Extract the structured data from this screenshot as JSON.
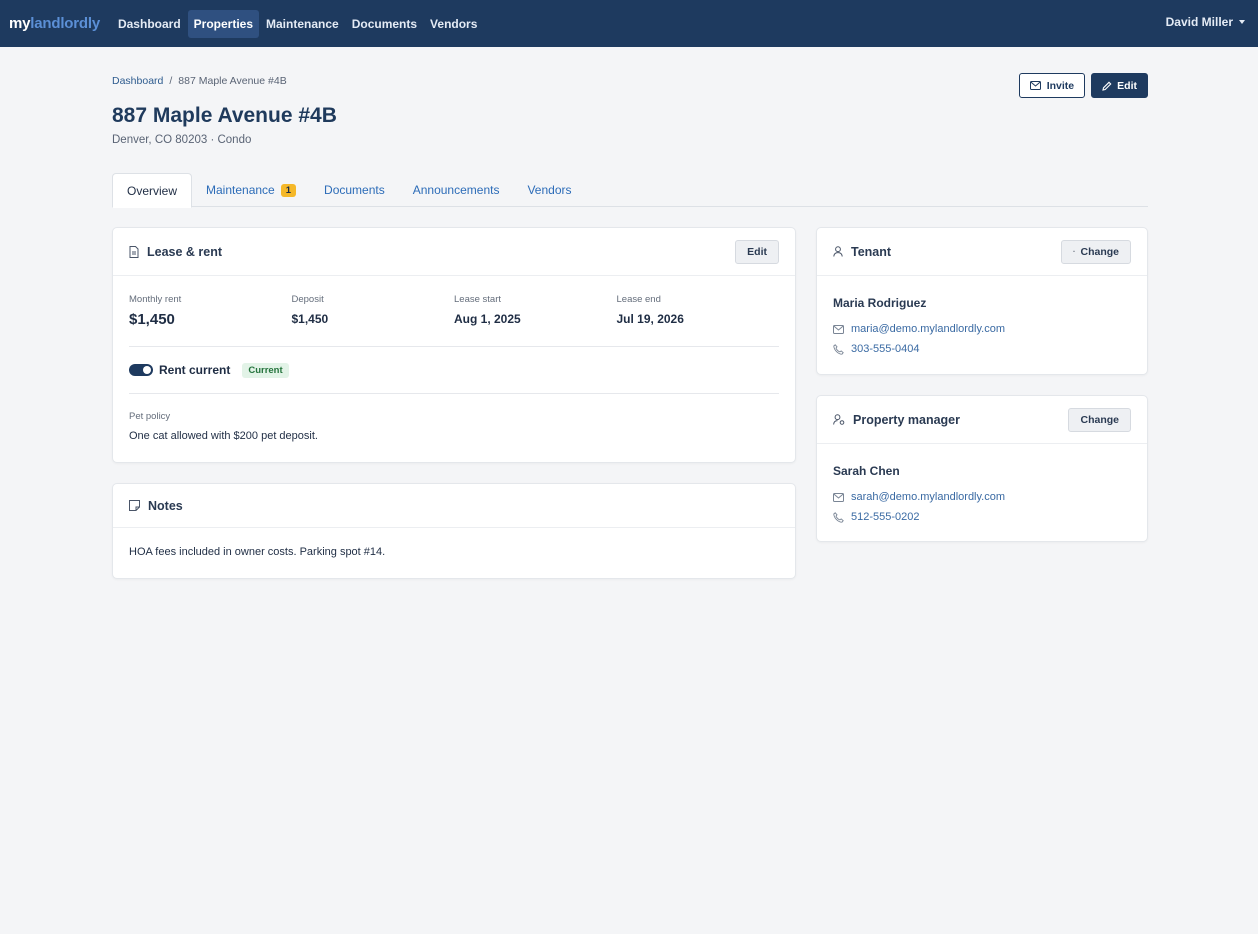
{
  "brand": {
    "part1": "my",
    "part2": "landlordly"
  },
  "nav": [
    {
      "label": "Dashboard"
    },
    {
      "label": "Properties"
    },
    {
      "label": "Maintenance"
    },
    {
      "label": "Documents"
    },
    {
      "label": "Vendors"
    }
  ],
  "user": {
    "name": "David Miller"
  },
  "breadcrumb": {
    "home": "Dashboard",
    "sep": "/",
    "current": "887 Maple Avenue #4B"
  },
  "actions": {
    "invite": "Invite",
    "edit": "Edit"
  },
  "property": {
    "title": "887 Maple Avenue #4B",
    "subtitle": "Denver, CO 80203 · Condo"
  },
  "tabs": [
    {
      "label": "Overview"
    },
    {
      "label": "Maintenance",
      "badge": "1"
    },
    {
      "label": "Documents"
    },
    {
      "label": "Announcements"
    },
    {
      "label": "Vendors"
    }
  ],
  "lease": {
    "title": "Lease & rent",
    "edit": "Edit",
    "monthly_rent_label": "Monthly rent",
    "monthly_rent": "$1,450",
    "deposit_label": "Deposit",
    "deposit": "$1,450",
    "lease_start_label": "Lease start",
    "lease_start": "Aug 1, 2025",
    "lease_end_label": "Lease end",
    "lease_end": "Jul 19, 2026",
    "rent_current_label": "Rent current",
    "rent_status": "Current",
    "pet_policy_label": "Pet policy",
    "pet_policy": "One cat allowed with $200 pet deposit."
  },
  "notes": {
    "title": "Notes",
    "text": "HOA fees included in owner costs. Parking spot #14."
  },
  "tenant": {
    "title": "Tenant",
    "change": "Change",
    "name": "Maria Rodriguez",
    "email": "maria@demo.mylandlordly.com",
    "phone": "303-555-0404"
  },
  "manager": {
    "title": "Property manager",
    "change": "Change",
    "name": "Sarah Chen",
    "email": "sarah@demo.mylandlordly.com",
    "phone": "512-555-0202"
  },
  "colors": {
    "navbar": "#1e3a5f",
    "accent": "#2c6cb8",
    "badge_warning": "#f5b829",
    "badge_success": "#24733c"
  }
}
